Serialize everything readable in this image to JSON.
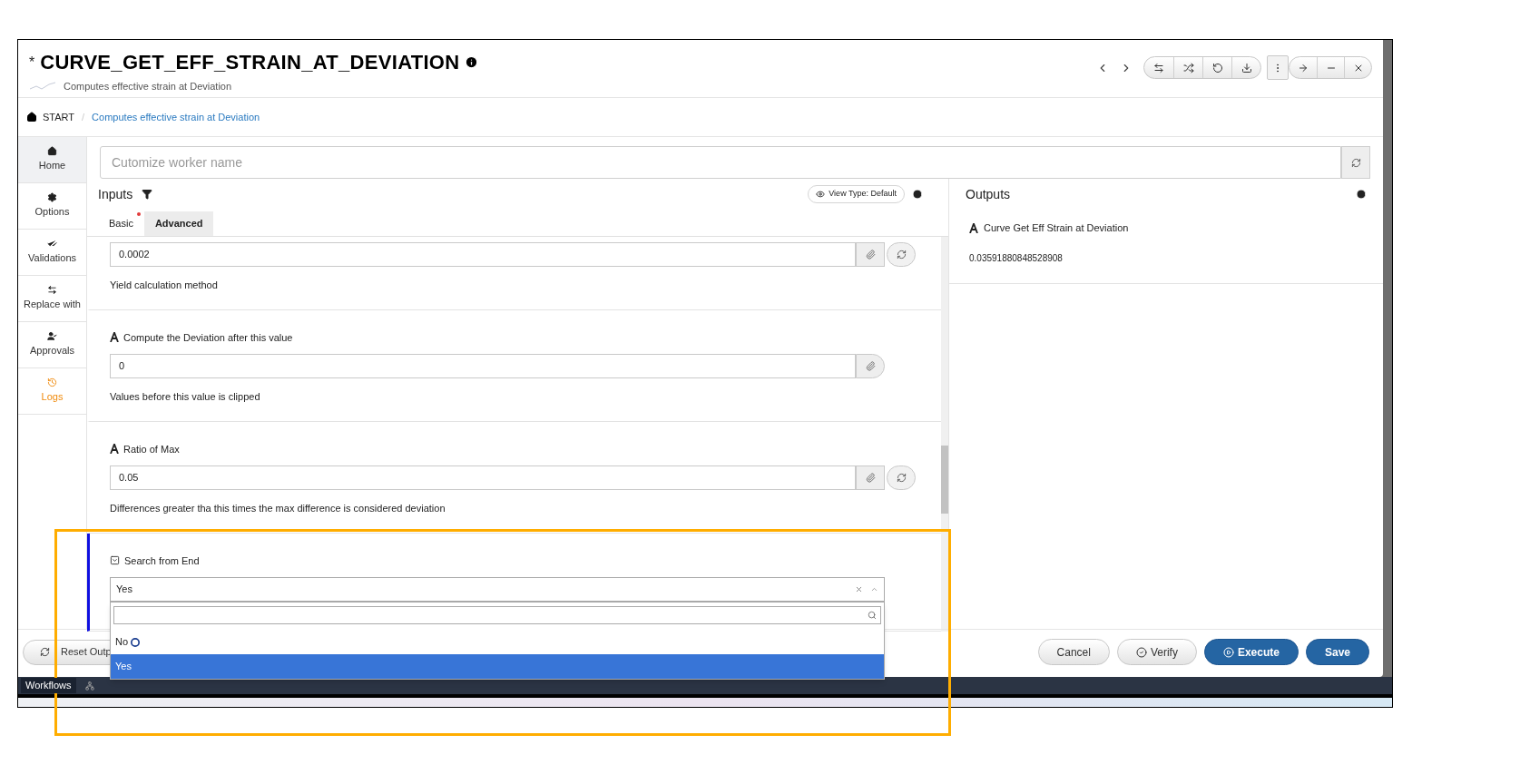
{
  "window": {
    "modified_mark": "*",
    "title": "CURVE_GET_EFF_STRAIN_AT_DEVIATION",
    "subtitle": "Computes effective strain at Deviation"
  },
  "breadcrumb": {
    "items": [
      "START",
      "Computes effective strain at Deviation"
    ],
    "separator": "/"
  },
  "sidebar": [
    {
      "label": "Home",
      "selected": true,
      "highlighted": false
    },
    {
      "label": "Options",
      "selected": false,
      "highlighted": false
    },
    {
      "label": "Validations",
      "selected": false,
      "highlighted": false
    },
    {
      "label": "Replace with",
      "selected": false,
      "highlighted": false
    },
    {
      "label": "Approvals",
      "selected": false,
      "highlighted": false
    },
    {
      "label": "Logs",
      "selected": false,
      "highlighted": true
    }
  ],
  "worker_name": {
    "placeholder": "Cutomize worker name"
  },
  "inputs": {
    "title": "Inputs",
    "view_type": "View Type: Default",
    "tabs": [
      {
        "label": "Basic",
        "required": true,
        "selected": false
      },
      {
        "label": "Advanced",
        "required": false,
        "selected": true
      }
    ],
    "fields": [
      {
        "kind": "text",
        "value": "0.0002",
        "hint": "Yield calculation method",
        "resettable": true,
        "active": false
      },
      {
        "kind": "text",
        "label": "Compute the Deviation after this value",
        "value": "0",
        "hint": "Values before this value is clipped",
        "resettable": false,
        "active": false
      },
      {
        "kind": "text",
        "label": "Ratio of Max",
        "value": "0.05",
        "hint": "Differences greater tha this times the max difference is considered deviation",
        "resettable": true,
        "active": false
      },
      {
        "kind": "select",
        "label": "Search from End",
        "value": "Yes",
        "expanded": true,
        "active": true,
        "options": [
          {
            "label": "No",
            "selected": false
          },
          {
            "label": "Yes",
            "selected": true
          }
        ]
      }
    ]
  },
  "outputs": {
    "title": "Outputs",
    "items": [
      {
        "label": "Curve Get Eff Strain at Deviation",
        "value": "0.03591880848528908"
      }
    ]
  },
  "footer": {
    "reset": "Reset Outp",
    "buttons": [
      {
        "label": "Cancel",
        "kind": "plain"
      },
      {
        "label": "Verify",
        "kind": "verify"
      },
      {
        "label": "Execute",
        "kind": "run"
      },
      {
        "label": "Save",
        "kind": "primary"
      }
    ]
  },
  "taskbar": {
    "label": "Workflows"
  }
}
